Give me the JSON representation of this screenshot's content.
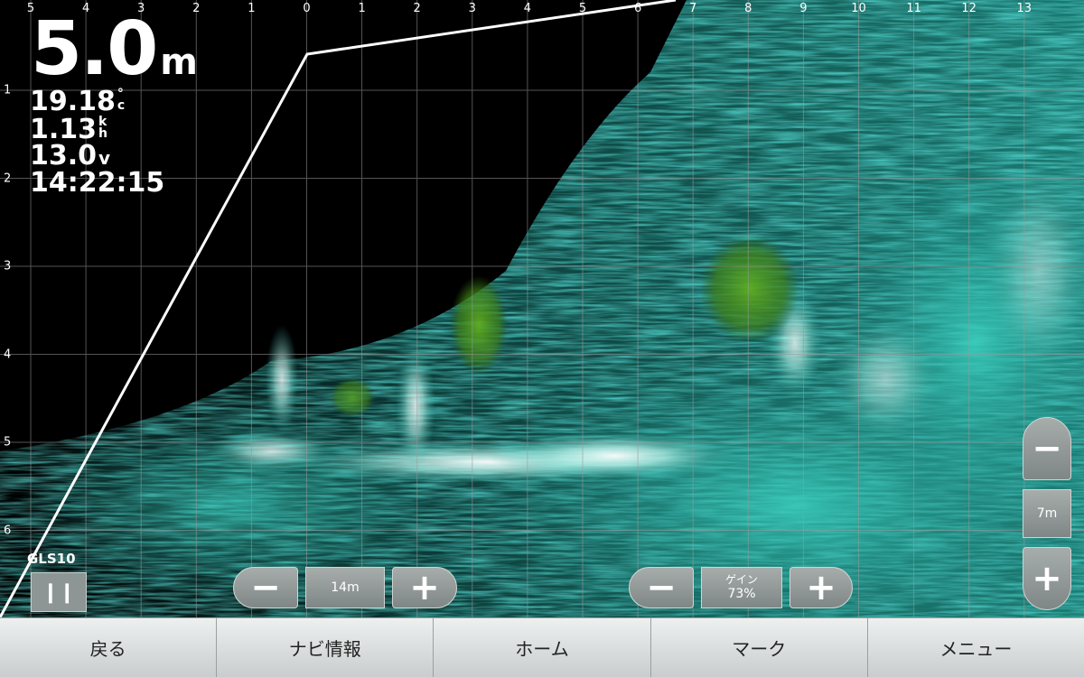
{
  "sonar": {
    "x_ticks": [
      "5",
      "4",
      "3",
      "2",
      "1",
      "0",
      "1",
      "2",
      "3",
      "4",
      "5",
      "6",
      "7",
      "8",
      "9",
      "10",
      "11",
      "12",
      "13"
    ],
    "y_ticks": [
      "1",
      "2",
      "3",
      "4",
      "5",
      "6"
    ],
    "colors": {
      "background": "#000000",
      "echo": "#2fb5a8",
      "echo_strong": "#e8fffb",
      "fish": "#4f9a1e",
      "grid": "#9a9a9a",
      "boat_line": "#ffffff"
    }
  },
  "readouts": {
    "depth_value": "5.0",
    "depth_unit": "m",
    "water_temp": "19.18",
    "water_temp_unit": "°c",
    "speed": "1.13",
    "speed_unit": "k h",
    "voltage": "13.0",
    "voltage_unit": "v",
    "time": "14:22:15"
  },
  "source": {
    "label": "GLS10",
    "pause_icon": "pause-icon"
  },
  "range_control": {
    "minus_icon": "minus-icon",
    "value": "14m",
    "plus_icon": "plus-icon"
  },
  "gain_control": {
    "minus_icon": "minus-icon",
    "label": "ゲイン",
    "value": "73%",
    "plus_icon": "plus-icon"
  },
  "zoom_control": {
    "minus_icon": "minus-icon",
    "value": "7m",
    "plus_icon": "plus-icon"
  },
  "softkeys": [
    {
      "label": "戻る"
    },
    {
      "label": "ナビ情報"
    },
    {
      "label": "ホーム"
    },
    {
      "label": "マーク"
    },
    {
      "label": "メニュー"
    }
  ]
}
